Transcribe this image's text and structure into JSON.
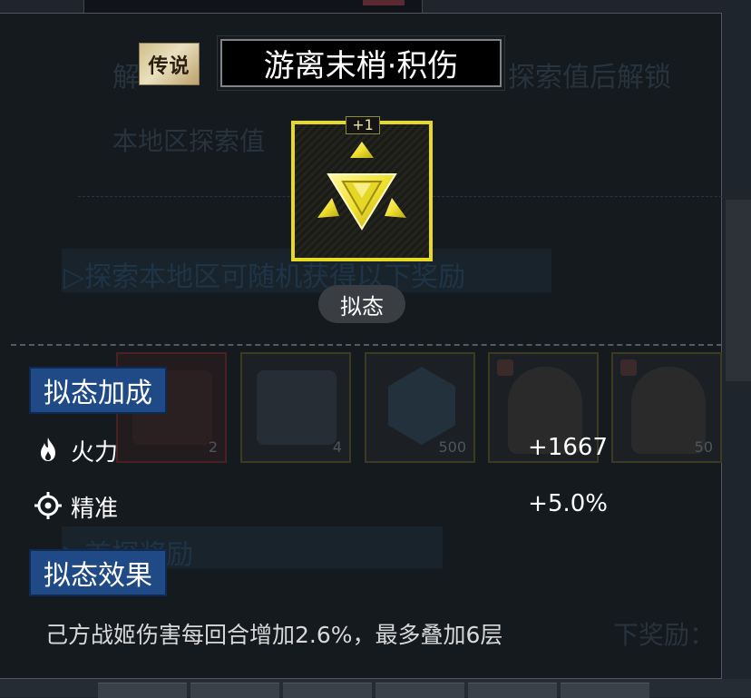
{
  "background": {
    "ghost_texts": [
      "解",
      "探索值后解锁",
      "本地区探索值",
      "▷探索本地区可随机获得以下奖励",
      "▷首探奖励",
      "下奖励："
    ],
    "reward_slots": [
      {
        "count": "2",
        "style": "red"
      },
      {
        "count": "4",
        "style": "book"
      },
      {
        "count": "500",
        "style": "hex"
      },
      {
        "count": "",
        "style": "face"
      },
      {
        "count": "50",
        "style": "face"
      }
    ]
  },
  "header": {
    "rarity_label": "传说",
    "title": "游离末梢·积伤"
  },
  "mimic": {
    "level_badge": "+1",
    "icon": "golden-triangle-gem-icon",
    "type_label": "拟态"
  },
  "bonus": {
    "label": "拟态加成",
    "stats": [
      {
        "icon": "flame-icon",
        "name": "火力",
        "value": "+1667"
      },
      {
        "icon": "crosshair-icon",
        "name": "精准",
        "value": "+5.0%"
      }
    ]
  },
  "effect": {
    "label": "拟态效果",
    "description": "己方战姬伤害每回合增加2.6%，最多叠加6层"
  },
  "colors": {
    "accent_gold": "#e8da24",
    "label_blue": "#1f4a86",
    "panel_bg": "#151a1f"
  }
}
